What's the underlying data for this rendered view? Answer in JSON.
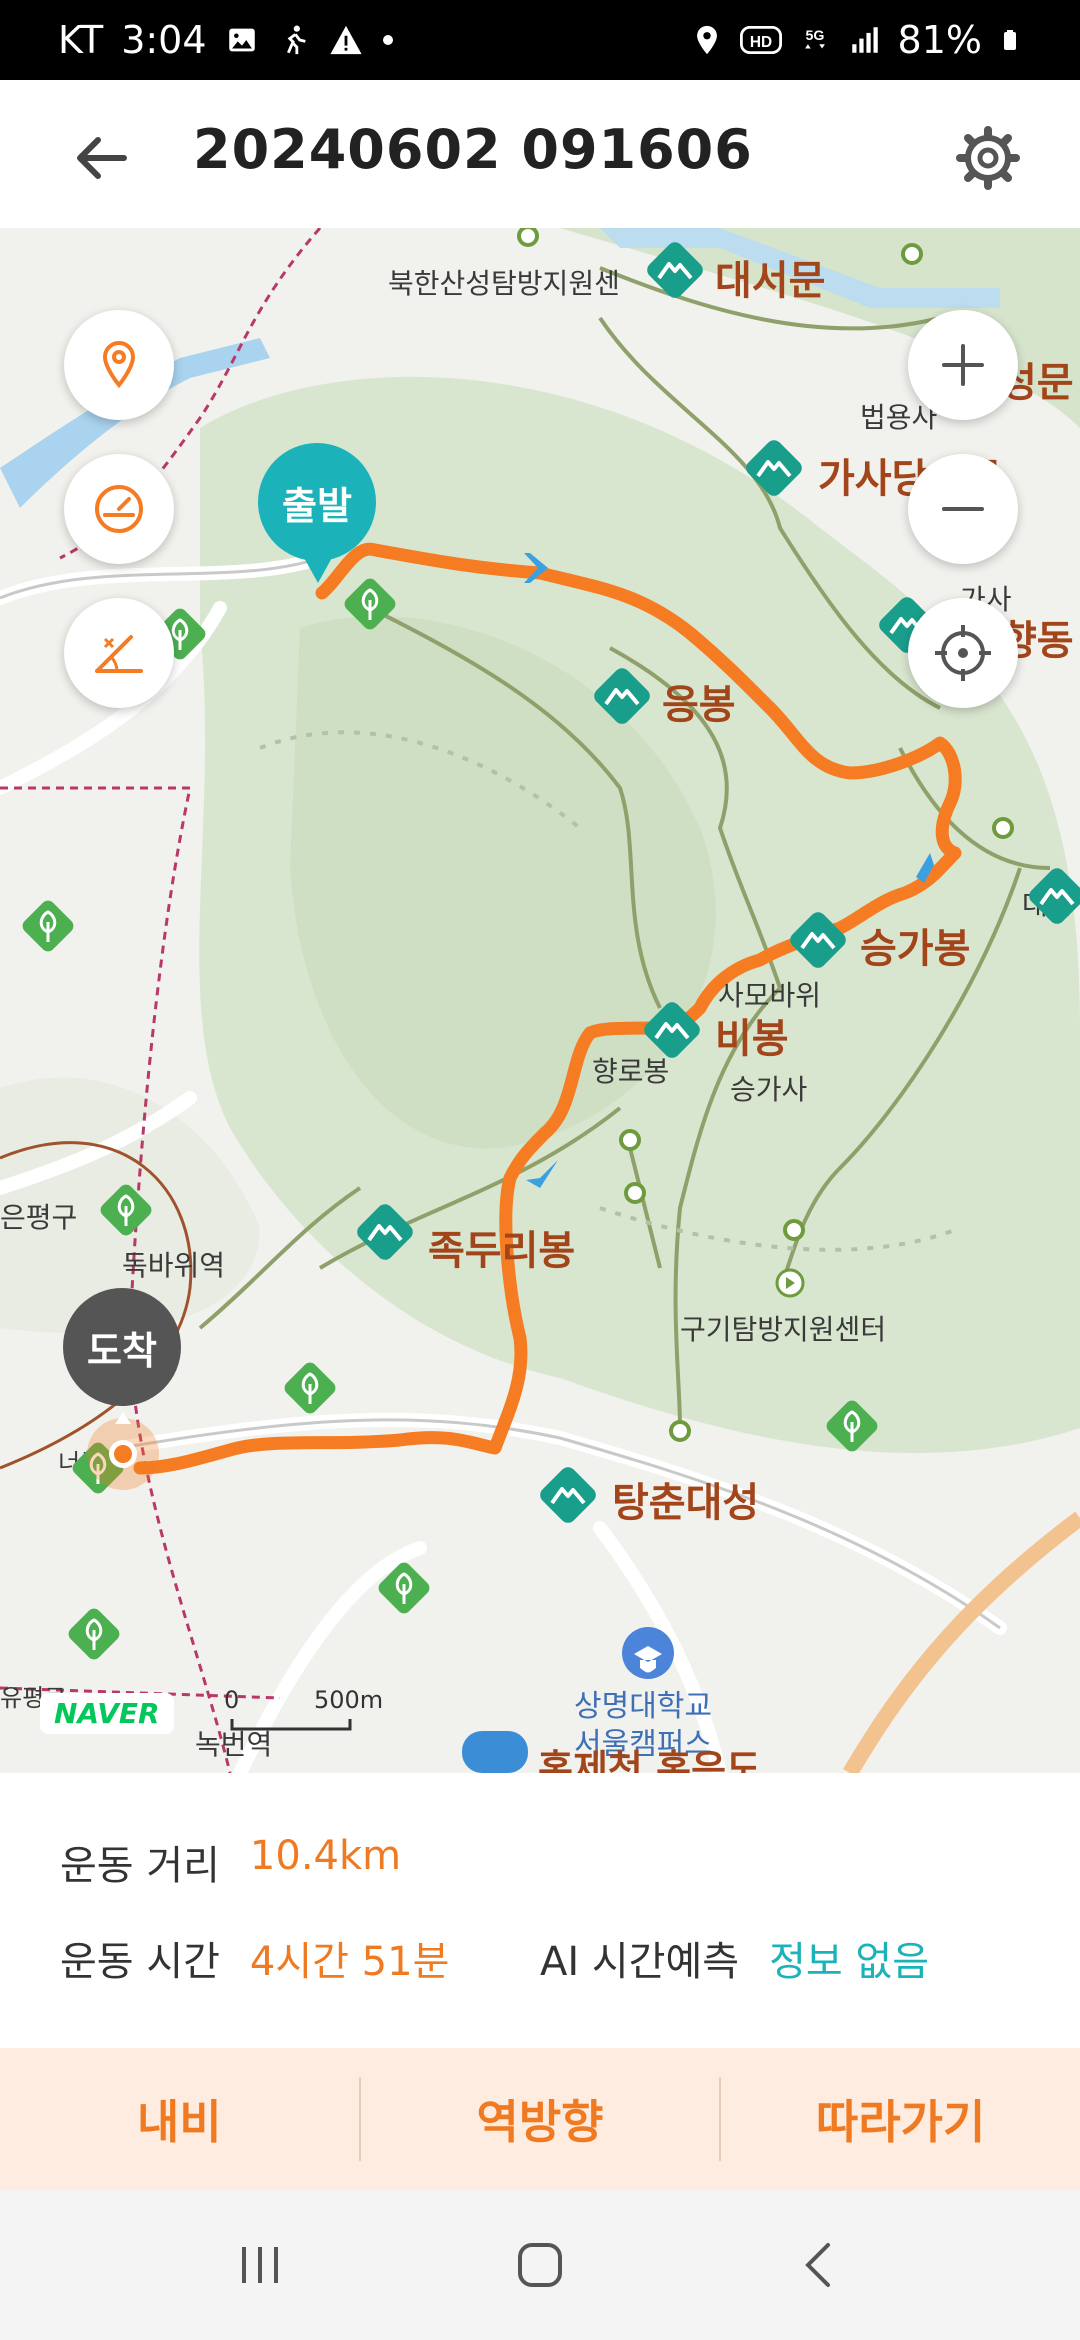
{
  "status_bar": {
    "carrier": "KT",
    "time": "3:04",
    "battery": "81%",
    "icons": [
      "gallery-icon",
      "running-app-icon",
      "warning-icon",
      "dot-icon",
      "location-icon",
      "hd-icon",
      "5g-icon",
      "signal-icon",
      "battery-icon"
    ]
  },
  "header": {
    "title": "20240602 091606",
    "icons": [
      "back-arrow-icon",
      "gear-icon"
    ]
  },
  "map": {
    "start_label": "출발",
    "end_label": "도착",
    "peaks": [
      "대서문",
      "가사당암문",
      "응봉",
      "승가봉",
      "비봉",
      "족두리봉",
      "탕춘대성"
    ],
    "partial_labels": {
      "peak_top_right": "성문",
      "peak_right": "향동",
      "center_label": "가사"
    },
    "place_labels": [
      "북한산성탐방지원센",
      "법용사",
      "사모바위",
      "향로봉",
      "승가사",
      "구기탐방지원센터",
      "독바위역",
      "은평구",
      "대남",
      "녹번역",
      "상명대학교",
      "서울캠퍼스",
      "홍제천 홍은도",
      "유평로",
      "너부"
    ],
    "scale": {
      "zero": "0",
      "distance": "500m"
    },
    "brand": "NAVER",
    "controls": [
      "location-pin-icon",
      "speedometer-icon",
      "slope-icon",
      "zoom-in-icon",
      "zoom-out-icon",
      "crosshair-icon"
    ],
    "colors": {
      "route": "#f57c22",
      "start_pin": "#1bb3b9",
      "end_pin": "#555555",
      "peak_marker": "#1a9e8c",
      "tree_marker": "#4caf50"
    }
  },
  "info": {
    "distance_label": "운동 거리",
    "distance_value": "10.4km",
    "time_label": "운동 시간",
    "time_value": "4시간 51분",
    "ai_label": "AI 시간예측",
    "ai_value": "정보 없음"
  },
  "actions": {
    "navi": "내비",
    "reverse": "역방향",
    "follow": "따라가기"
  },
  "navbar": {
    "icons": [
      "recent-apps-icon",
      "home-icon",
      "back-icon"
    ]
  }
}
